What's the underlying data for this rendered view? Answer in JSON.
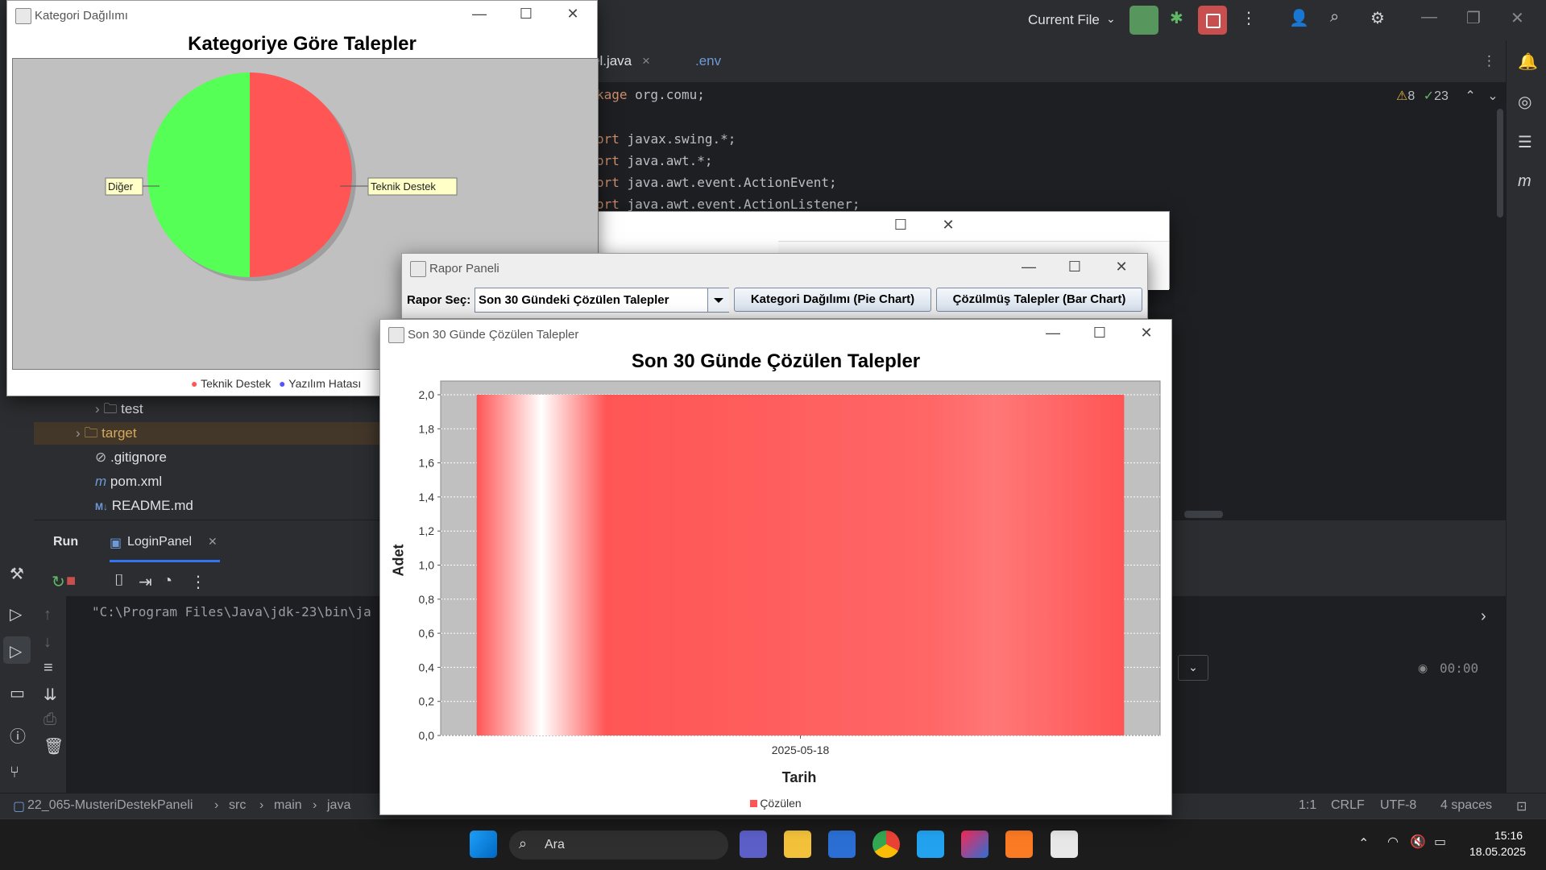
{
  "ide": {
    "run_config": "Current File",
    "tabs": [
      {
        "label": "el.java"
      },
      {
        "label": ".env"
      }
    ],
    "inspections": {
      "warnings": "8",
      "ok": "23"
    },
    "code_lines": [
      {
        "kw": "kage",
        "rest": " org.comu;"
      },
      {
        "kw": "ort",
        "rest": " javax.swing.*;"
      },
      {
        "kw": "ort",
        "rest": " java.awt.*;"
      },
      {
        "kw": "ort",
        "rest": " java.awt.event.ActionEvent;"
      },
      {
        "kw": "ort",
        "rest": " java.awt.event.ActionListener;"
      }
    ],
    "project_tree": [
      {
        "label": "test"
      },
      {
        "label": "target"
      },
      {
        "label": ".gitignore"
      },
      {
        "label": "pom.xml"
      },
      {
        "label": "README.md"
      }
    ],
    "run_panel": {
      "tab_run": "Run",
      "tab_config": "LoginPanel",
      "console_line": "\"C:\\Program Files\\Java\\jdk-23\\bin\\ja",
      "timer": "00:00"
    },
    "status_bar": {
      "breadcrumb": [
        "22_065-MusteriDestekPaneli",
        "src",
        "main",
        "java"
      ],
      "position": "1:1",
      "line_sep": "CRLF",
      "encoding": "UTF-8",
      "indent": "4 spaces"
    }
  },
  "pie_window": {
    "title": "Kategori Dağılımı",
    "chart_title": "Kategoriye Göre Talepler",
    "labels": {
      "left": "Diğer",
      "right": "Teknik Destek"
    },
    "legend": [
      "Teknik Destek",
      "Yazılım Hatası"
    ],
    "colors": {
      "teknik": "#ff5555",
      "diger": "#55ff55",
      "yazilim": "#5555ff"
    }
  },
  "report_window": {
    "title": "Rapor Paneli",
    "select_label": "Rapor Seç:",
    "select_value": "Son 30 Gündeki Çözülen Talepler",
    "btn_pie": "Kategori Dağılımı (Pie Chart)",
    "btn_bar": "Çözülmüş Talepler (Bar Chart)"
  },
  "bar_window": {
    "title": "Son 30 Günde Çözülen Talepler",
    "chart_title": "Son 30 Günde Çözülen Talepler",
    "ylabel": "Adet",
    "xlabel": "Tarih",
    "legend": "Çözülen"
  },
  "chart_data": [
    {
      "type": "pie",
      "title": "Kategoriye Göre Talepler",
      "categories": [
        "Teknik Destek",
        "Diğer"
      ],
      "values": [
        50,
        50
      ],
      "legend": [
        "Teknik Destek",
        "Yazılım Hatası"
      ],
      "legend_position": "bottom"
    },
    {
      "type": "bar",
      "title": "Son 30 Günde Çözülen Talepler",
      "categories": [
        "2025-05-18"
      ],
      "series": [
        {
          "name": "Çözülen",
          "values": [
            2.0
          ]
        }
      ],
      "xlabel": "Tarih",
      "ylabel": "Adet",
      "ylim": [
        0,
        2.0
      ],
      "yticks": [
        "0,0",
        "0,2",
        "0,4",
        "0,6",
        "0,8",
        "1,0",
        "1,2",
        "1,4",
        "1,6",
        "1,8",
        "2,0"
      ],
      "legend_position": "bottom",
      "grid": true,
      "color": "#ff5555"
    }
  ],
  "taskbar": {
    "search": "Ara",
    "time": "15:16",
    "date": "18.05.2025"
  }
}
